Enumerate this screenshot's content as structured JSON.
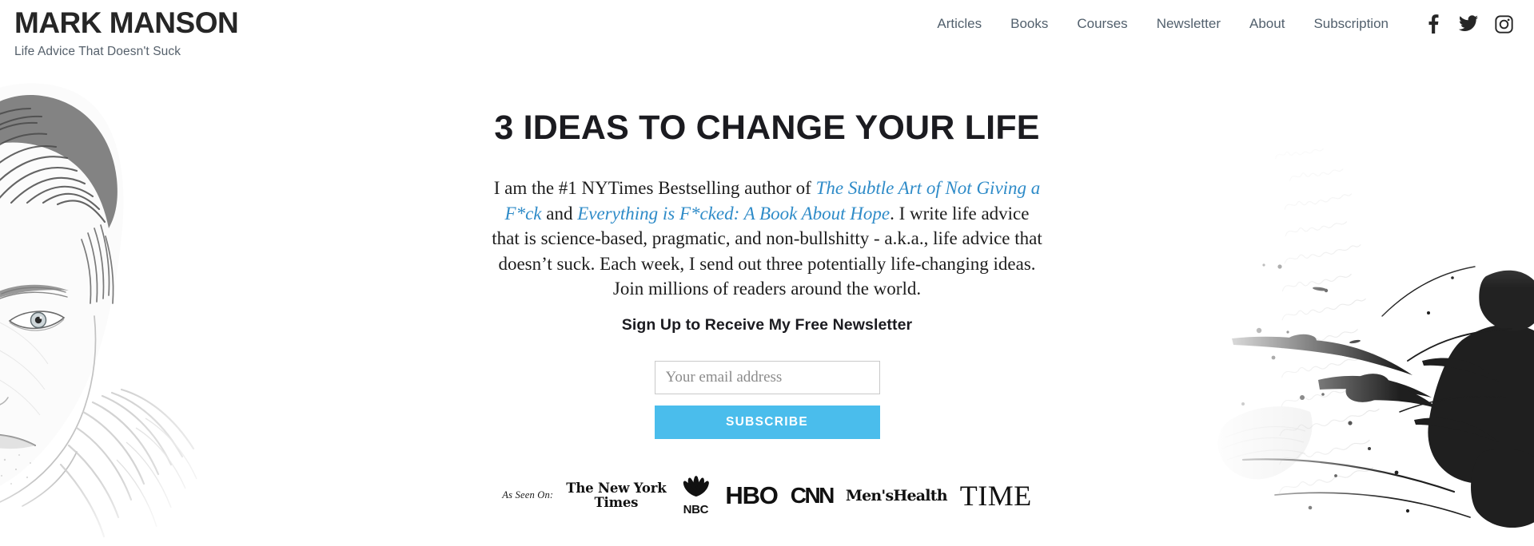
{
  "brand": {
    "title": "MARK MANSON",
    "tagline": "Life Advice That Doesn't Suck"
  },
  "nav": {
    "items": [
      {
        "label": "Articles",
        "name": "nav-link-articles"
      },
      {
        "label": "Books",
        "name": "nav-link-books"
      },
      {
        "label": "Courses",
        "name": "nav-link-courses"
      },
      {
        "label": "Newsletter",
        "name": "nav-link-newsletter"
      },
      {
        "label": "About",
        "name": "nav-link-about"
      },
      {
        "label": "Subscription",
        "name": "nav-link-subscription"
      }
    ],
    "social": [
      {
        "icon": "facebook-icon",
        "label": "Facebook"
      },
      {
        "icon": "twitter-icon",
        "label": "Twitter"
      },
      {
        "icon": "instagram-icon",
        "label": "Instagram"
      }
    ]
  },
  "hero": {
    "heading": "3 IDEAS TO CHANGE YOUR LIFE",
    "paragraph": {
      "part1": "I am the #1 NYTimes Bestselling author of ",
      "link1": "The Subtle Art of Not Giving a F*ck",
      "part2": " and ",
      "link2": "Everything is F*cked: A Book About Hope",
      "part3": ". I write life advice that is science-based, pragmatic, and non-bullshitty - a.k.a., life advice that doesn’t suck. Each week, I send out three potentially life-changing ideas. Join millions of readers around the world."
    },
    "signup_heading": "Sign Up to Receive My Free Newsletter"
  },
  "form": {
    "email_placeholder": "Your email address",
    "email_value": "",
    "subscribe_label": "SUBSCRIBE"
  },
  "as_seen_on": {
    "label": "As Seen On:",
    "logos": [
      {
        "name": "logo-nyt",
        "line1": "The New York",
        "line2": "Times"
      },
      {
        "name": "logo-nbc",
        "text": "NBC"
      },
      {
        "name": "logo-hbo",
        "text": "HBO"
      },
      {
        "name": "logo-cnn",
        "text": "CNN"
      },
      {
        "name": "logo-mens-health",
        "text": "Men'sHealth"
      },
      {
        "name": "logo-time",
        "text": "TIME"
      }
    ]
  },
  "art": {
    "left_alt": "pencil-sketch-portrait-of-mark-manson",
    "right_alt": "black-ink-splatter-with-handwriting-texture"
  },
  "colors": {
    "accent_blue": "#4abdec",
    "link_blue": "#2e8bc8",
    "heading_dark": "#1b1b20",
    "nav_text": "#52606d",
    "background": "#ffffff"
  }
}
